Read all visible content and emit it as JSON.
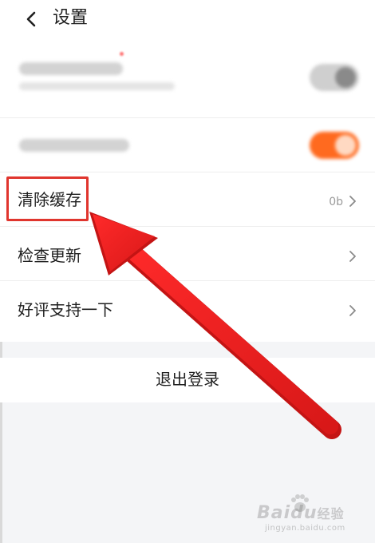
{
  "header": {
    "title": "设置",
    "back_icon": "chevron-left-icon"
  },
  "settings": {
    "clear_cache": {
      "label": "清除缓存",
      "value": "0b"
    },
    "check_update": {
      "label": "检查更新"
    },
    "rate_app": {
      "label": "好评支持一下"
    }
  },
  "logout": {
    "label": "退出登录"
  },
  "watermark": {
    "brand": "Baidu",
    "brand_suffix": "经验",
    "url": "jingyan.baidu.com"
  },
  "colors": {
    "annotation_red": "#e0352e",
    "toggle_on": "#ff6a1f",
    "toggle_off": "#cfcfcf"
  }
}
